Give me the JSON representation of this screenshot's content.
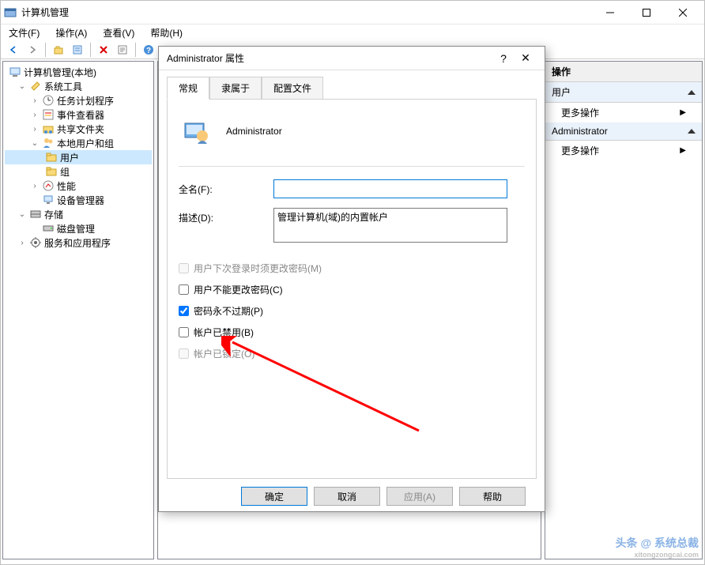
{
  "window": {
    "title": "计算机管理"
  },
  "menubar": {
    "file": "文件(F)",
    "action": "操作(A)",
    "view": "查看(V)",
    "help": "帮助(H)"
  },
  "tree": {
    "root": "计算机管理(本地)",
    "systools": "系统工具",
    "scheduler": "任务计划程序",
    "eventviewer": "事件查看器",
    "sharedfolders": "共享文件夹",
    "localusers": "本地用户和组",
    "users": "用户",
    "groups": "组",
    "performance": "性能",
    "devicemgr": "设备管理器",
    "storage": "存储",
    "diskmgmt": "磁盘管理",
    "services": "服务和应用程序"
  },
  "actions": {
    "header": "操作",
    "section1": "用户",
    "more1": "更多操作",
    "section2": "Administrator",
    "more2": "更多操作"
  },
  "dialog": {
    "title": "Administrator 属性",
    "tabs": {
      "general": "常规",
      "memberof": "隶属于",
      "profile": "配置文件"
    },
    "username": "Administrator",
    "fullname_label": "全名(F):",
    "fullname_value": "",
    "description_label": "描述(D):",
    "description_value": "管理计算机(域)的内置帐户",
    "cb_nextlogon": "用户下次登录时须更改密码(M)",
    "cb_cannotchange": "用户不能更改密码(C)",
    "cb_neverexpires": "密码永不过期(P)",
    "cb_disabled": "帐户已禁用(B)",
    "cb_locked": "帐户已锁定(O)",
    "buttons": {
      "ok": "确定",
      "cancel": "取消",
      "apply": "应用(A)",
      "help": "帮助"
    }
  },
  "watermark": {
    "main": "头条 @ 系统总裁",
    "sub": "xitongzongcai.com"
  }
}
